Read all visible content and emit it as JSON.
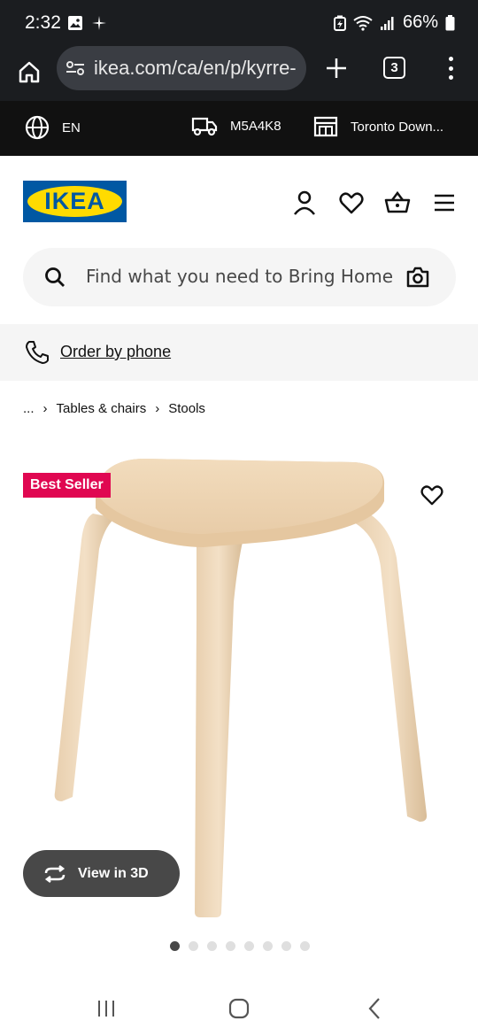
{
  "status_bar": {
    "time": "2:32",
    "battery": "66%",
    "icons": [
      "gallery-icon",
      "sparkle-icon",
      "battery-saver-icon",
      "wifi-icon",
      "signal-icon",
      "battery-icon"
    ]
  },
  "browser": {
    "url": "ikea.com/ca/en/p/kyrre-",
    "tab_count": "3"
  },
  "ikea_strip": {
    "language": "EN",
    "postal_code": "M5A4K8",
    "store": "Toronto Down..."
  },
  "header": {
    "logo_text": "IKEA",
    "icons": [
      "account-icon",
      "wishlist-icon",
      "cart-icon",
      "hamburger-menu-icon"
    ]
  },
  "search": {
    "placeholder": "Find what you need to Bring Home"
  },
  "order_phone": {
    "label": "Order by phone"
  },
  "breadcrumb": {
    "items": [
      "...",
      "Tables & chairs",
      "Stools"
    ]
  },
  "product": {
    "badge": "Best Seller",
    "view_3d_label": "View in 3D",
    "image_count": 8,
    "active_image": 1
  },
  "colors": {
    "ikea_blue": "#0058a3",
    "ikea_yellow": "#ffdb00",
    "best_seller_red": "#e00751",
    "dark_bar": "#1b1d20"
  }
}
